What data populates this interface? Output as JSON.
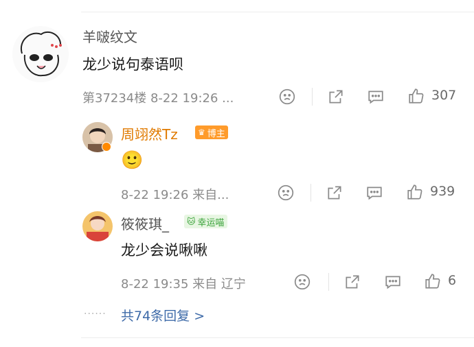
{
  "comment": {
    "username": "羊啵纹文",
    "text": "龙少说句泰语呗",
    "meta": "第37234楼 8-22 19:26 ...",
    "likes": "307"
  },
  "replies": [
    {
      "username": "周翊然Tz",
      "badge": "博主",
      "text": "🙂",
      "meta": "8-22 19:26 来自...",
      "likes": "939"
    },
    {
      "username": "筱筱琪_",
      "badge": "幸运喵",
      "text": "龙少会说啾啾",
      "meta": "8-22 19:35 来自 辽宁",
      "likes": "6"
    }
  ],
  "more_replies": "共74条回复 >",
  "dots": "······",
  "colors": {
    "username": "#555555",
    "host": "#e07a00",
    "link": "#3d6aa8"
  },
  "icons": [
    "sad-face-icon",
    "share-icon",
    "comment-icon",
    "like-icon"
  ]
}
